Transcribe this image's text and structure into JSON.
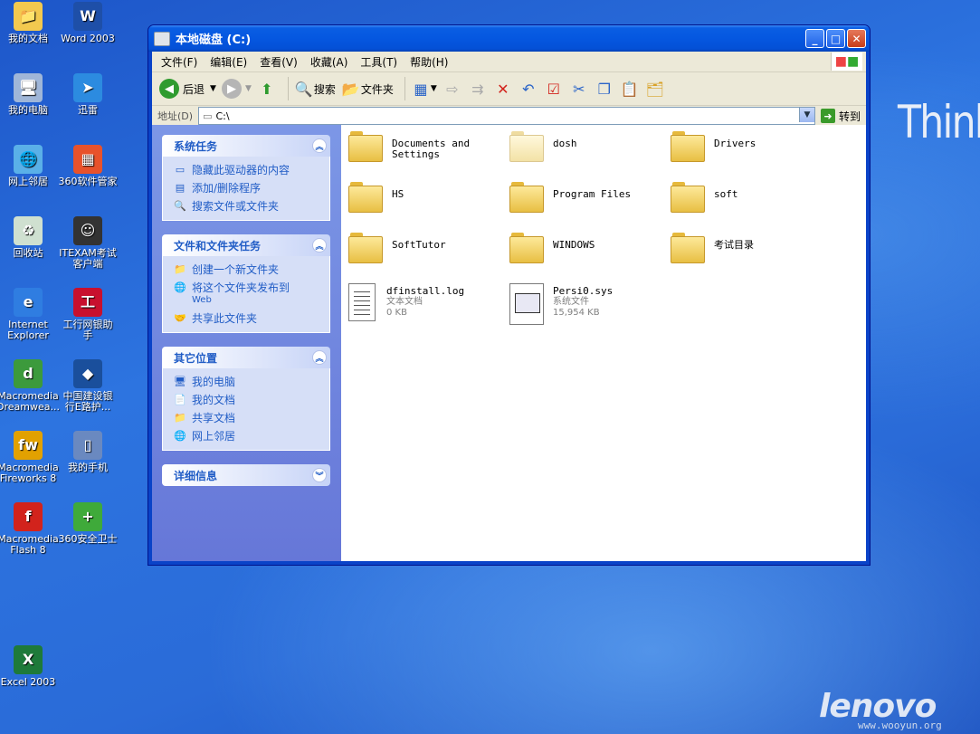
{
  "desktop": {
    "icons": [
      {
        "label": "我的文档",
        "color": "#f3c94f",
        "glyph": "📁"
      },
      {
        "label": "Word 2003",
        "color": "#1e4fa8",
        "glyph": "W"
      },
      {
        "label": "我的电脑",
        "color": "#9fb6d8",
        "glyph": "🖥"
      },
      {
        "label": "迅雷",
        "color": "#2c8be0",
        "glyph": "➤"
      },
      {
        "label": "网上邻居",
        "color": "#5ab0e8",
        "glyph": "🌐"
      },
      {
        "label": "360软件管家",
        "color": "#e8522b",
        "glyph": "▦"
      },
      {
        "label": "回收站",
        "color": "#cfe0d0",
        "glyph": "♻"
      },
      {
        "label": "ITEXAM考试\n客户端",
        "color": "#333333",
        "glyph": "☺"
      },
      {
        "label": "Internet\nExplorer",
        "color": "#2f7de1",
        "glyph": "e"
      },
      {
        "label": "工行网银助\n手",
        "color": "#c8102e",
        "glyph": "工"
      },
      {
        "label": "Macromedia\nDreamwea...",
        "color": "#3c9a3c",
        "glyph": "d"
      },
      {
        "label": "中国建设银\n行E路护...",
        "color": "#1a4f9c",
        "glyph": "◆"
      },
      {
        "label": "Macromedia\nFireworks 8",
        "color": "#e2a100",
        "glyph": "fw"
      },
      {
        "label": "我的手机",
        "color": "#6a89c0",
        "glyph": "▯"
      },
      {
        "label": "Macromedia\nFlash 8",
        "color": "#d2231c",
        "glyph": "f"
      },
      {
        "label": "360安全卫士",
        "color": "#3faa3a",
        "glyph": "+"
      },
      {
        "label": "Excel 2003",
        "color": "#1e7a3a",
        "glyph": "X"
      }
    ]
  },
  "brand": {
    "think": "Think",
    "lenovo": "lenovo",
    "watermark": "www.wooyun.org"
  },
  "window": {
    "title": "本地磁盘 (C:)",
    "menu": [
      "文件(F)",
      "编辑(E)",
      "查看(V)",
      "收藏(A)",
      "工具(T)",
      "帮助(H)"
    ],
    "toolbar": {
      "back": "后退",
      "search": "搜索",
      "folders": "文件夹"
    },
    "address": {
      "label": "地址(D)",
      "value": "C:\\",
      "go": "转到"
    },
    "panels": [
      {
        "title": "系统任务",
        "chevron": "up",
        "tasks": [
          {
            "label": "隐藏此驱动器的内容",
            "sub": "",
            "icon": "drive-icon"
          },
          {
            "label": "添加/删除程序",
            "sub": "",
            "icon": "programs-icon"
          },
          {
            "label": "搜索文件或文件夹",
            "sub": "",
            "icon": "search-icon"
          }
        ]
      },
      {
        "title": "文件和文件夹任务",
        "chevron": "up",
        "tasks": [
          {
            "label": "创建一个新文件夹",
            "sub": "",
            "icon": "new-folder-icon"
          },
          {
            "label": "将这个文件夹发布到",
            "sub": "Web",
            "icon": "publish-icon"
          },
          {
            "label": "共享此文件夹",
            "sub": "",
            "icon": "share-icon"
          }
        ]
      },
      {
        "title": "其它位置",
        "chevron": "up",
        "tasks": [
          {
            "label": "我的电脑",
            "sub": "",
            "icon": "computer-icon"
          },
          {
            "label": "我的文档",
            "sub": "",
            "icon": "documents-icon"
          },
          {
            "label": "共享文档",
            "sub": "",
            "icon": "shared-docs-icon"
          },
          {
            "label": "网上邻居",
            "sub": "",
            "icon": "network-icon"
          }
        ]
      },
      {
        "title": "详细信息",
        "chevron": "down",
        "tasks": []
      }
    ],
    "files": [
      {
        "name": "Documents and\nSettings",
        "type": "folder"
      },
      {
        "name": "dosh",
        "type": "folder-hidden"
      },
      {
        "name": "Drivers",
        "type": "folder"
      },
      {
        "name": "HS",
        "type": "folder"
      },
      {
        "name": "Program Files",
        "type": "folder"
      },
      {
        "name": "soft",
        "type": "folder"
      },
      {
        "name": "SoftTutor",
        "type": "folder"
      },
      {
        "name": "WINDOWS",
        "type": "folder"
      },
      {
        "name": "考试目录",
        "type": "folder"
      },
      {
        "name": "dfinstall.log",
        "type": "doc",
        "kind": "文本文档",
        "size": "0 KB"
      },
      {
        "name": "Persi0.sys",
        "type": "sys",
        "kind": "系统文件",
        "size": "15,954 KB"
      }
    ]
  }
}
